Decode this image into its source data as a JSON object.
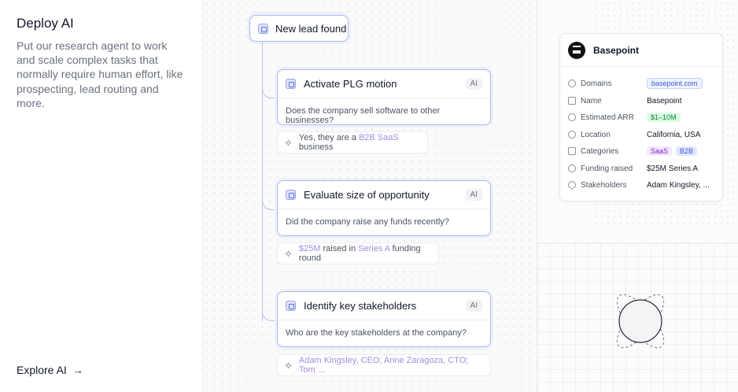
{
  "left": {
    "title": "Deploy AI",
    "description": "Put our research agent to work and scale complex tasks that normally require human effort, like prospecting, lead routing and more.",
    "explore_label": "Explore AI",
    "explore_arrow": "→"
  },
  "workflow": {
    "trigger_label": "New lead found",
    "steps": [
      {
        "title": "Activate PLG motion",
        "badge": "AI",
        "question": "Does the company sell software to other businesses?",
        "answer": {
          "pre": "Yes, they are a ",
          "hl1": "B2B SaaS",
          "mid": " business",
          "hl2": "",
          "post": ""
        }
      },
      {
        "title": "Evaluate size of opportunity",
        "badge": "AI",
        "question": "Did the company raise any funds recently?",
        "answer": {
          "pre": "",
          "hl1": "$25M",
          "mid": " raised in ",
          "hl2": "Series A",
          "post": " funding round"
        }
      },
      {
        "title": "Identify key stakeholders",
        "badge": "AI",
        "question": "Who are the key stakeholders at the company?",
        "answer": {
          "pre": "",
          "hl1": "Adam Kingsley, CEO; Anne Zaragoza, CTO; Tom ...",
          "mid": "",
          "hl2": "",
          "post": ""
        }
      }
    ]
  },
  "company": {
    "name": "Basepoint",
    "fields": {
      "domains_label": "Domains",
      "domains_value": "basepoint.com",
      "name_label": "Name",
      "name_value": "Basepoint",
      "arr_label": "Estimated ARR",
      "arr_value": "$1–10M",
      "location_label": "Location",
      "location_value": "California, USA",
      "categories_label": "Categories",
      "category_1": "SaaS",
      "category_2": "B2B",
      "funding_label": "Funding raised",
      "funding_value": "$25M Series A",
      "stakeholders_label": "Stakeholders",
      "stakeholders_value": "Adam Kingsley, ..."
    }
  },
  "colors": {
    "accent_border": "#a9b8ef",
    "highlight_text": "#a78bdf",
    "arr_green": "#15803d"
  }
}
